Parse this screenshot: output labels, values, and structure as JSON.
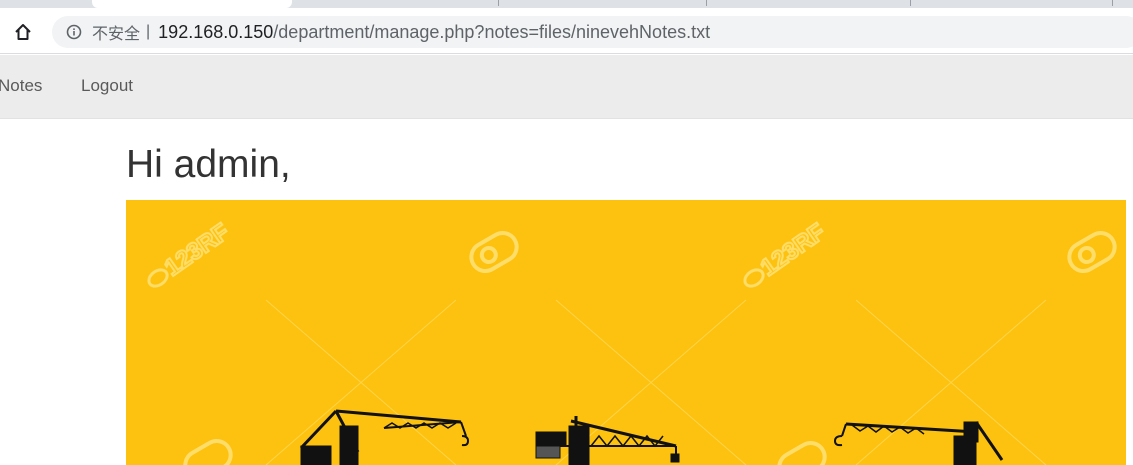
{
  "browser": {
    "security_label": "不安全",
    "security_separator": "|",
    "url_host": "192.168.0.150",
    "url_path": "/department/manage.php?notes=files/ninevehNotes.txt"
  },
  "navbar": {
    "items": [
      {
        "label": "Notes"
      },
      {
        "label": "Logout"
      }
    ]
  },
  "main": {
    "greeting": "Hi admin,",
    "banner": {
      "background_color": "#fdc20f",
      "watermark_text": "123RF",
      "image_subject": "construction-cranes-silhouette"
    }
  }
}
